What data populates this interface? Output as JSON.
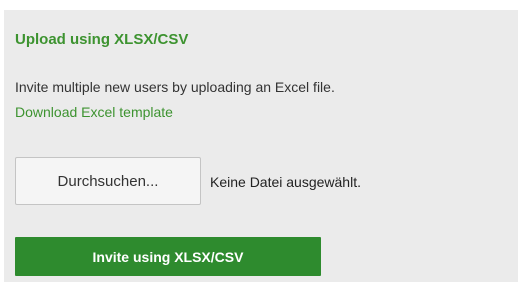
{
  "upload_section": {
    "title": "Upload using XLSX/CSV",
    "description": "Invite multiple new users by uploading an Excel file.",
    "template_link_label": "Download Excel template",
    "browse_button_label": "Durchsuchen...",
    "file_status": "Keine Datei ausgewählt.",
    "invite_button_label": "Invite using XLSX/CSV"
  },
  "colors": {
    "accent_green": "#3d9330",
    "button_green": "#2e8b2e",
    "panel_background": "#ebebeb"
  }
}
